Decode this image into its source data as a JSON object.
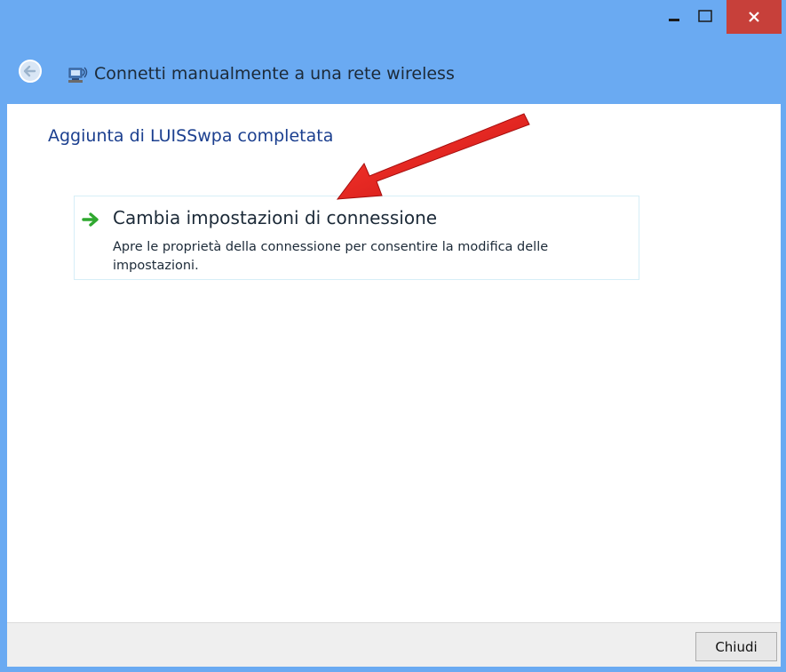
{
  "window": {
    "title_bar": {
      "minimize_icon": "minimize-icon",
      "maximize_icon": "maximize-icon",
      "close_icon": "close-icon"
    },
    "nav": {
      "back_icon": "back-arrow-icon",
      "network_icon": "wireless-network-icon",
      "title": "Connetti manualmente a una rete wireless"
    },
    "colors": {
      "frame": "#6aaaf2",
      "close": "#c7403a",
      "heading": "#1b3f8f",
      "option_arrow": "#2fa82f",
      "annotation_arrow": "#e02020"
    }
  },
  "main": {
    "heading": "Aggiunta di LUISSwpa completata",
    "option": {
      "icon": "green-arrow-icon",
      "title": "Cambia impostazioni di connessione",
      "description": "Apre le proprietà della connessione per consentire la modifica delle impostazioni."
    }
  },
  "footer": {
    "close_label": "Chiudi"
  }
}
